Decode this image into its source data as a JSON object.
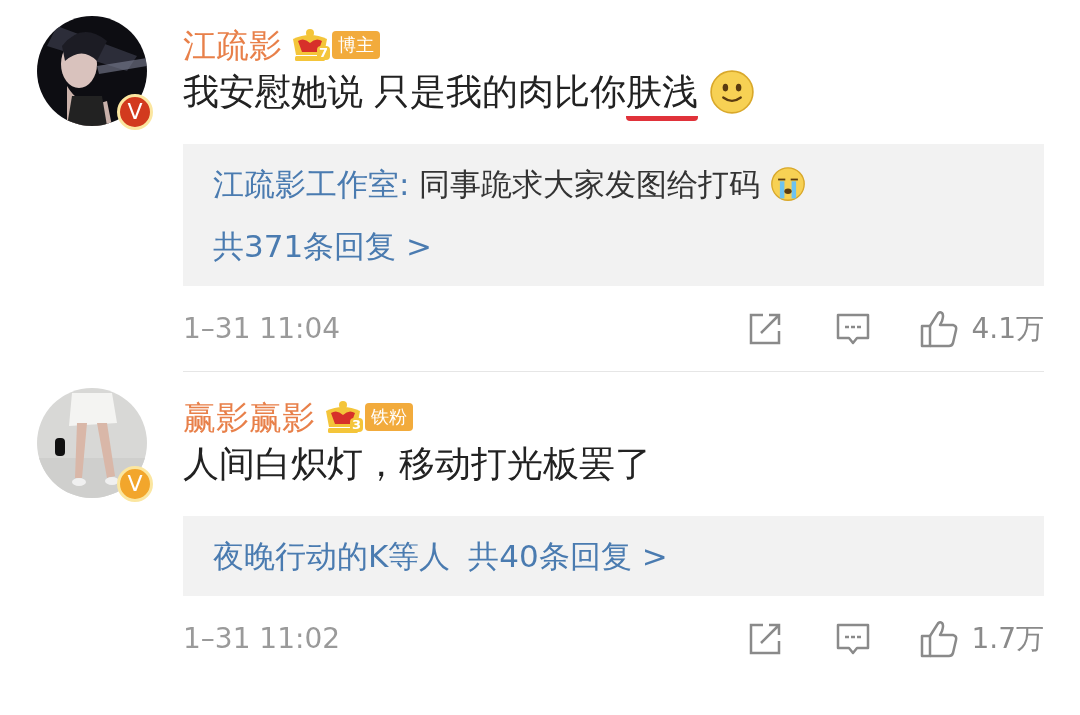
{
  "comments": [
    {
      "author": "江疏影",
      "level": "7",
      "tag": "博主",
      "verified": {
        "label": "V",
        "color": "#d23a1e"
      },
      "text_parts": [
        {
          "text": "我安慰她说 只是我的肉比你",
          "underlined": false
        },
        {
          "text": "肤浅",
          "underlined": true
        }
      ],
      "emoji": {
        "kind": "smile"
      },
      "reply_box": {
        "preview": {
          "author": "江疏影工作室:",
          "text": "同事跪求大家发图给打码",
          "emoji": {
            "kind": "cry"
          }
        },
        "more": "共371条回复 >"
      },
      "time": "1–31 11:04",
      "likes": "4.1万"
    },
    {
      "author": "赢影赢影",
      "level": "3",
      "tag": "铁粉",
      "verified": {
        "label": "V",
        "color": "#f2a62c"
      },
      "text_parts": [
        {
          "text": "人间白炽灯，移动打光板罢了",
          "underlined": false
        }
      ],
      "reply_box": {
        "repliers": "夜晚行动的K等人",
        "more": "共40条回复 >"
      },
      "time": "1–31 11:02",
      "likes": "1.7万"
    }
  ]
}
